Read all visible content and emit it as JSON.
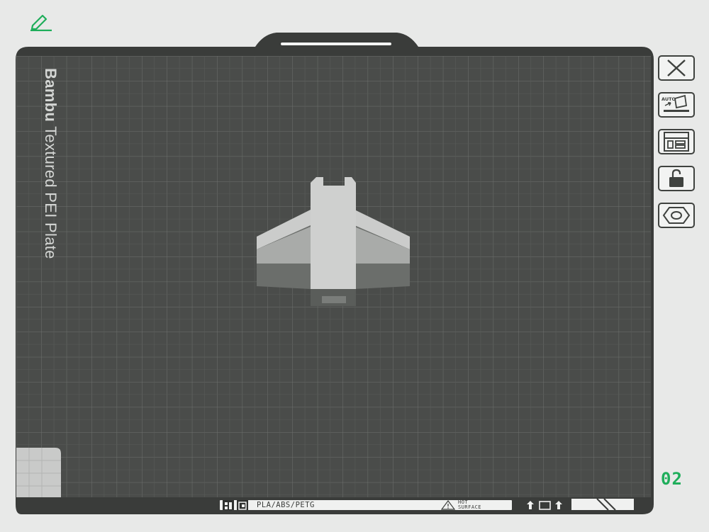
{
  "plate": {
    "name_bold": "Bambu",
    "name_rest": " Textured PEI Plate",
    "number": "02",
    "filament_types": "PLA/ABS/PETG",
    "warning": {
      "line1": "HOT",
      "line2": "SURFACE"
    }
  },
  "toolbar": {
    "items": [
      {
        "name": "delete",
        "icon": "close-icon"
      },
      {
        "name": "auto-orient",
        "icon": "auto-orient-icon",
        "badge": "AUTO"
      },
      {
        "name": "arrange",
        "icon": "layout-icon"
      },
      {
        "name": "lock",
        "icon": "unlock-icon"
      },
      {
        "name": "settings",
        "icon": "hex-nut-icon"
      }
    ]
  },
  "colors": {
    "accent": "#1fae5b",
    "plate": "#4a4c4a",
    "frame": "#3a3c3a",
    "grid": "#6a6d6a",
    "model": "#c8c9c8"
  }
}
